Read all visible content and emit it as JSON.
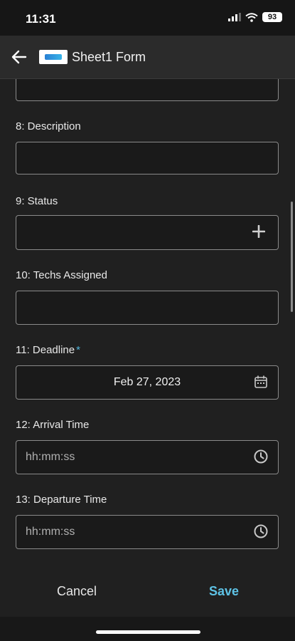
{
  "status_bar": {
    "time": "11:31",
    "battery": "93"
  },
  "header": {
    "title": "Sheet1 Form"
  },
  "fields": [
    {
      "label": "8: Description"
    },
    {
      "label": "9: Status"
    },
    {
      "label": "10: Techs Assigned"
    },
    {
      "label": "11: Deadline",
      "required_mark": "*",
      "value": "Feb 27, 2023"
    },
    {
      "label": "12: Arrival Time",
      "placeholder": "hh:mm:ss"
    },
    {
      "label": "13: Departure Time",
      "placeholder": "hh:mm:ss"
    }
  ],
  "footer": {
    "cancel_label": "Cancel",
    "save_label": "Save"
  },
  "colors": {
    "accent": "#5ec3e6",
    "background": "#202020",
    "field_border": "#8a8a8a"
  }
}
